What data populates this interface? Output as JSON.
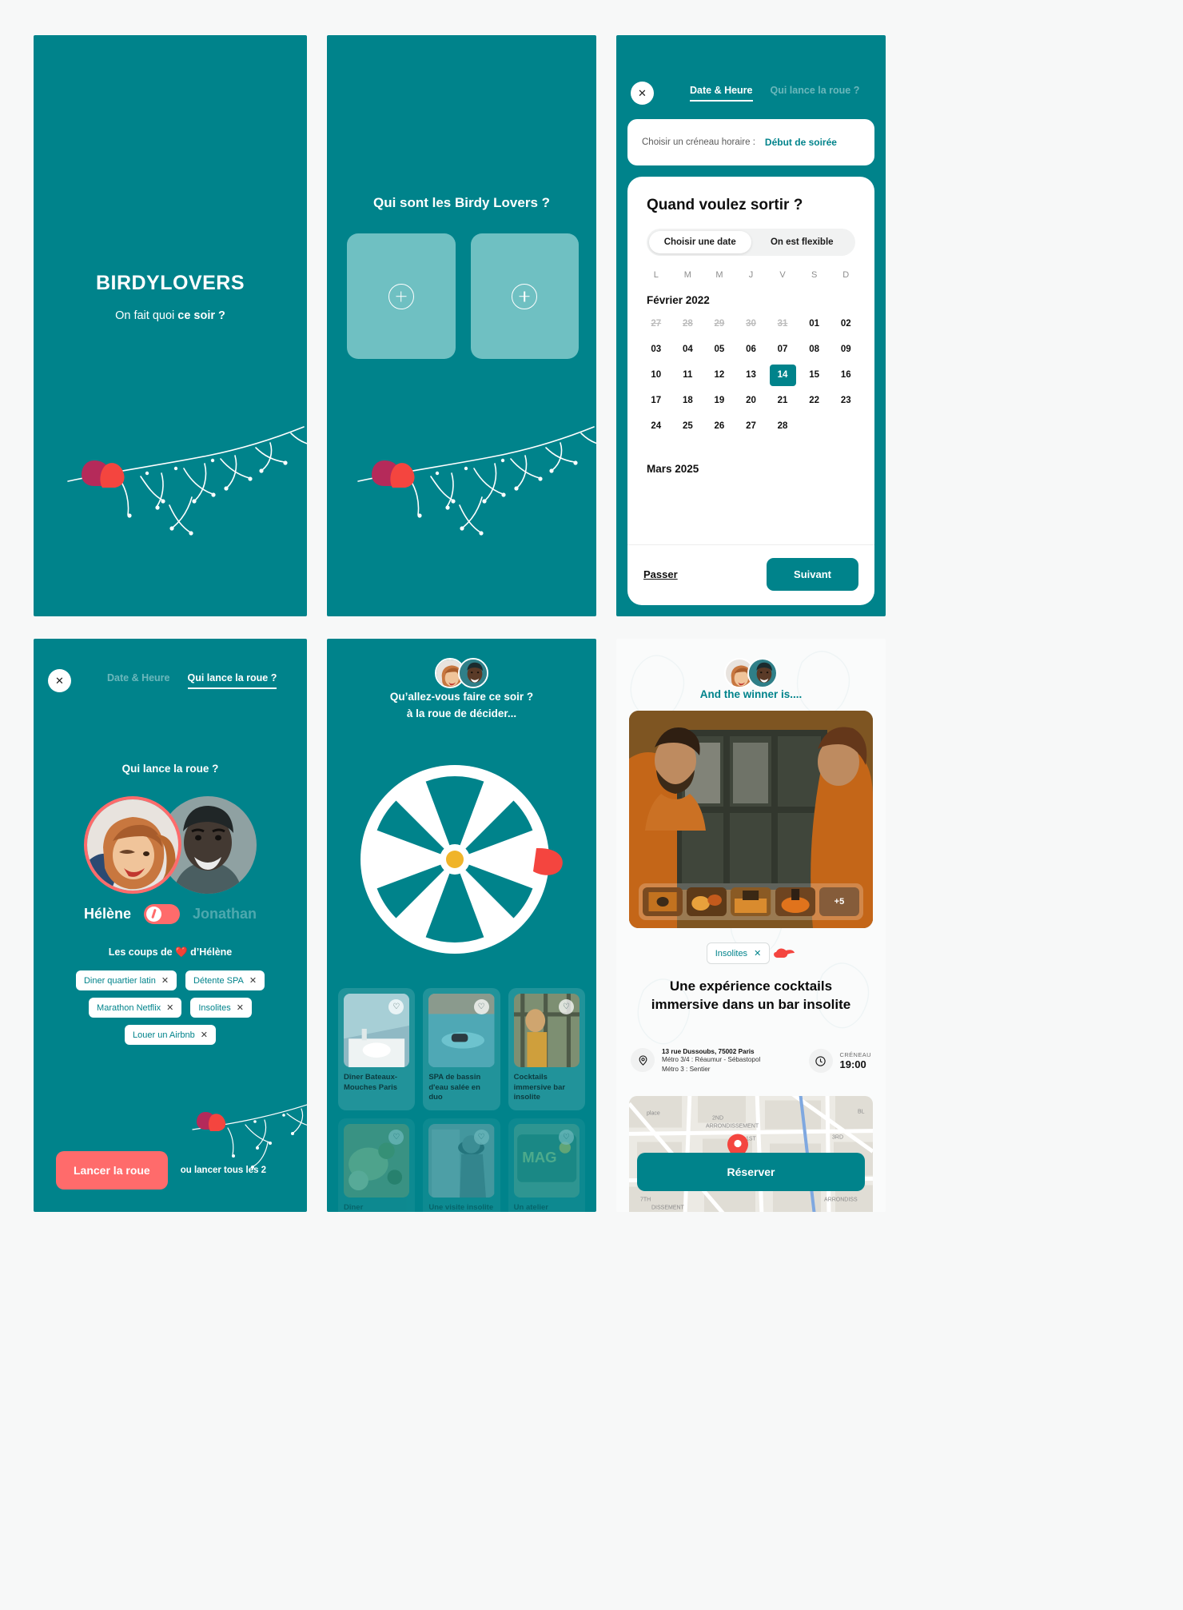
{
  "brand": {
    "teal": "#00838b",
    "coral": "#ff6b6b",
    "slot_fill": "#6fc0c2"
  },
  "screen1": {
    "title": "BIRDYLOVERS",
    "subtitle_plain": "On fait quoi ",
    "subtitle_bold": "ce soir ?"
  },
  "screen2": {
    "title": "Qui sont les Birdy Lovers ?",
    "slots": [
      {
        "icon": "plus-icon"
      },
      {
        "icon": "plus-icon"
      }
    ]
  },
  "screen3": {
    "close_icon": "close-icon",
    "tabs": [
      {
        "label": "Date & Heure",
        "active": true
      },
      {
        "label": "Qui lance la roue ?",
        "active": false
      }
    ],
    "slot_bar": {
      "label": "Choisir un créneau horaire :",
      "value": "Début de soirée"
    },
    "calendar": {
      "heading": "Quand voulez sortir ?",
      "segments": [
        {
          "label": "Choisir une date",
          "active": true
        },
        {
          "label": "On est flexible",
          "active": false
        }
      ],
      "weekdays": [
        "L",
        "M",
        "M",
        "J",
        "V",
        "S",
        "D"
      ],
      "month_1": "Février 2022",
      "month_2": "Mars 2025",
      "days": [
        {
          "n": "27",
          "state": "muted"
        },
        {
          "n": "28",
          "state": "muted"
        },
        {
          "n": "29",
          "state": "muted"
        },
        {
          "n": "30",
          "state": "muted"
        },
        {
          "n": "31",
          "state": "muted"
        },
        {
          "n": "01",
          "state": "normal"
        },
        {
          "n": "02",
          "state": "normal"
        },
        {
          "n": "03",
          "state": "normal"
        },
        {
          "n": "04",
          "state": "normal"
        },
        {
          "n": "05",
          "state": "normal"
        },
        {
          "n": "06",
          "state": "normal"
        },
        {
          "n": "07",
          "state": "normal"
        },
        {
          "n": "08",
          "state": "normal"
        },
        {
          "n": "09",
          "state": "normal"
        },
        {
          "n": "10",
          "state": "normal"
        },
        {
          "n": "11",
          "state": "normal"
        },
        {
          "n": "12",
          "state": "normal"
        },
        {
          "n": "13",
          "state": "normal"
        },
        {
          "n": "14",
          "state": "selected"
        },
        {
          "n": "15",
          "state": "normal"
        },
        {
          "n": "16",
          "state": "normal"
        },
        {
          "n": "17",
          "state": "normal"
        },
        {
          "n": "18",
          "state": "normal"
        },
        {
          "n": "19",
          "state": "normal"
        },
        {
          "n": "20",
          "state": "normal"
        },
        {
          "n": "21",
          "state": "normal"
        },
        {
          "n": "22",
          "state": "normal"
        },
        {
          "n": "23",
          "state": "normal"
        },
        {
          "n": "24",
          "state": "normal"
        },
        {
          "n": "25",
          "state": "normal"
        },
        {
          "n": "26",
          "state": "normal"
        },
        {
          "n": "27",
          "state": "normal"
        },
        {
          "n": "28",
          "state": "normal"
        },
        {
          "n": "",
          "state": "empty"
        },
        {
          "n": "",
          "state": "empty"
        }
      ],
      "skip_label": "Passer",
      "next_label": "Suivant"
    }
  },
  "screen4": {
    "close_icon": "close-icon",
    "tabs": [
      {
        "label": "Date & Heure",
        "active": false
      },
      {
        "label": "Qui lance la roue ?",
        "active": true
      }
    ],
    "question": "Qui lance la roue ?",
    "person_a": "Hélène",
    "person_b": "Jonathan",
    "toggle_state": "left",
    "favourites_label": "Les coups de ❤️ d’Hélène",
    "tags": [
      [
        "Diner quartier latin",
        "Détente SPA"
      ],
      [
        "Marathon Netflix",
        "Insolites"
      ],
      [
        "Louer un Airbnb"
      ]
    ],
    "cta": "Lancer la roue",
    "cta_note": "ou lancer tous les 2"
  },
  "screen5": {
    "question_line1": "Qu’allez-vous faire ce soir ?",
    "question_line2": "à la roue de décider...",
    "cards": [
      [
        {
          "title": "Dîner Bateaux-Mouches Paris",
          "dim": false
        },
        {
          "title": "SPA de bassin d'eau salée en duo",
          "dim": false
        },
        {
          "title": "Cocktails immersive bar insolite",
          "dim": false
        }
      ],
      [
        {
          "title": "Dîner oenologique accords mets & vins",
          "dim": true
        },
        {
          "title": "Une visite insolite “Le Paris du crime”",
          "dim": true
        },
        {
          "title": "Un atelier d'initiation au graffiti à Belleville",
          "dim": true
        }
      ]
    ]
  },
  "screen6": {
    "winner_label": "And the winner is....",
    "thumb_more": "+5",
    "tag": "Insolites",
    "title": "Une expérience cocktails immersive dans un bar insolite",
    "address_line1": "13 rue Dussoubs, 75002 Paris",
    "address_line2": "Métro 3/4 : Réaumur - Sébastopol",
    "address_line3": "Métro 3 : Sentier",
    "slot_label": "CRÉNEAU",
    "slot_value": "19:00",
    "map_labels": [
      "2ND ARRONDISSEMENT",
      "1ST",
      "3RD",
      "ARRONDISS",
      "place",
      "BL"
    ],
    "cta": "Réserver"
  }
}
